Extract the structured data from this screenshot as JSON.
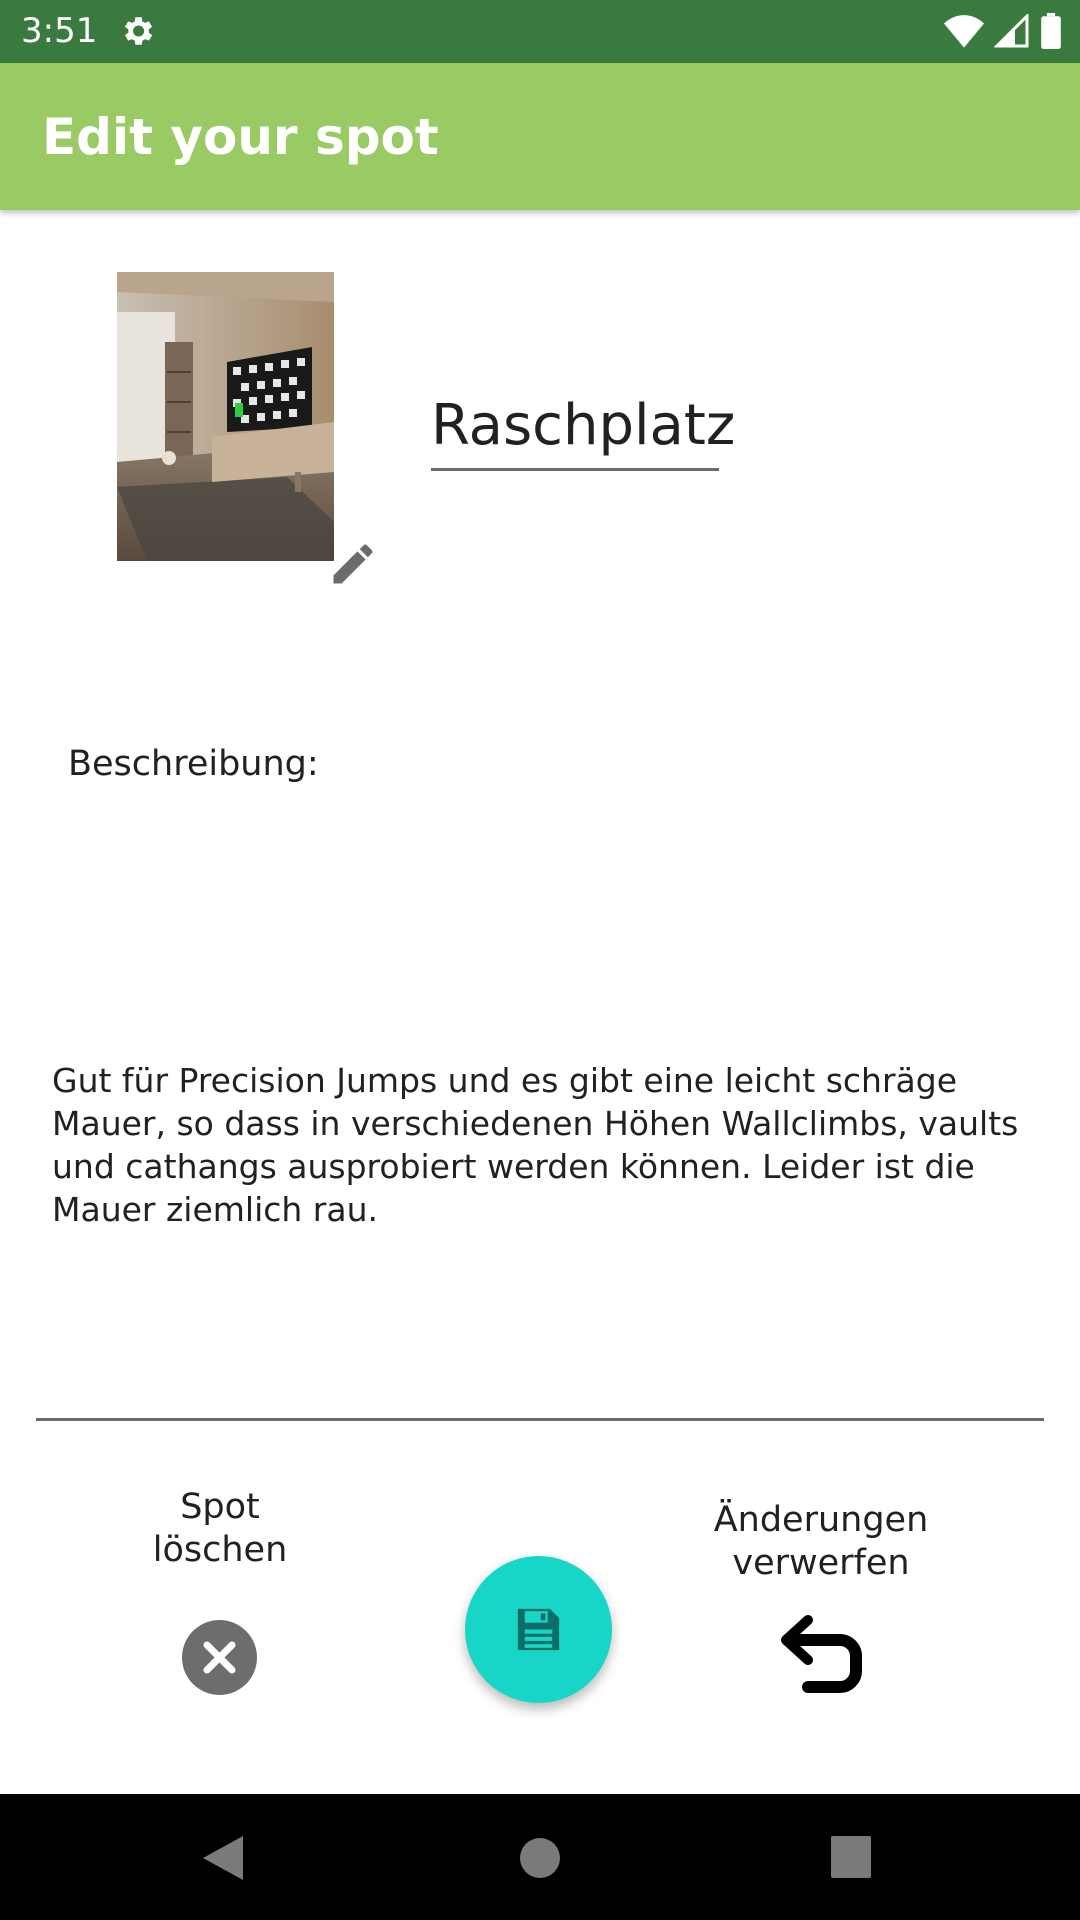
{
  "status_bar": {
    "time": "3:51",
    "icons": [
      "settings-gear-icon",
      "wifi-icon",
      "cell-signal-icon",
      "battery-icon"
    ]
  },
  "app_bar": {
    "title": "Edit your spot"
  },
  "spot": {
    "photo_icon": "room-photo",
    "name": "Raschplatz",
    "description_label": "Beschreibung:",
    "description": "Gut für Precision Jumps und es gibt eine leicht schräge Mauer, so dass in verschiedenen Höhen Wallclimbs, vaults und cathangs ausprobiert werden können. Leider ist die Mauer ziemlich rau."
  },
  "actions": {
    "delete_label": "Spot löschen",
    "discard_label": "Änderungen verwerfen",
    "save_icon": "save-icon"
  },
  "colors": {
    "status_bar": "#3b7a3e",
    "app_bar": "#9aca63",
    "fab": "#18d6c7",
    "delete": "#6d6d6d"
  },
  "nav_bar": {
    "icons": [
      "back-icon",
      "home-icon",
      "recents-icon"
    ]
  }
}
